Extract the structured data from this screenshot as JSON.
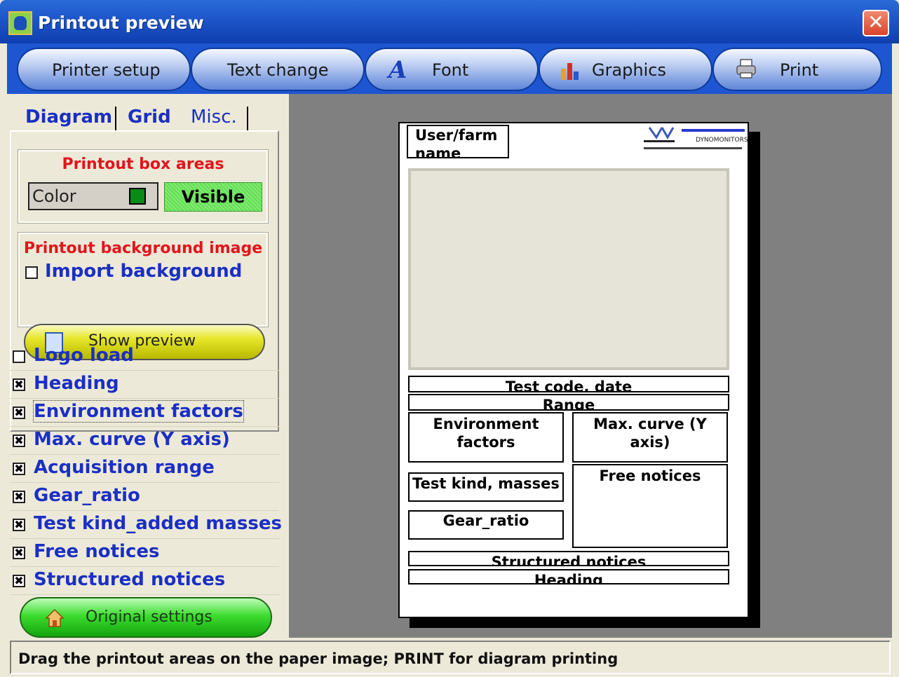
{
  "window": {
    "title": "Printout preview",
    "close_label": "✕"
  },
  "toolbar": {
    "printer_setup": "Printer setup",
    "text_change": "Text change",
    "font": "Font",
    "graphics": "Graphics",
    "print": "Print"
  },
  "tabs": {
    "diagram": "Diagram",
    "grid": "Grid",
    "misc": "Misc.",
    "active": "Misc."
  },
  "box_areas": {
    "title": "Printout box areas",
    "color_label": "Color",
    "color_value": "#0a8a16",
    "visible_label": "Visible"
  },
  "background": {
    "title": "Printout background image",
    "import_label": "Import background",
    "import_checked": false,
    "preview_label": "Show preview"
  },
  "options": [
    {
      "label": "Logo load",
      "mark": "",
      "checked": false
    },
    {
      "label": "Heading",
      "mark": "✖",
      "checked": true
    },
    {
      "label": "Environment factors",
      "mark": "✖",
      "checked": true
    },
    {
      "label": "Max. curve (Y axis)",
      "mark": "✖",
      "checked": true
    },
    {
      "label": "Acquisition range",
      "mark": "✖",
      "checked": true
    },
    {
      "label": "Gear_ratio",
      "mark": "✖",
      "checked": true
    },
    {
      "label": "Test kind_added masses",
      "mark": "✖",
      "checked": true
    },
    {
      "label": "Free notices",
      "mark": "✖",
      "checked": true
    },
    {
      "label": "Structured notices",
      "mark": "✖",
      "checked": true
    }
  ],
  "original_settings": "Original settings",
  "paper": {
    "user_farm": "User/farm name",
    "test_code": "Test code, date",
    "range": "Range",
    "environment": "Environment factors",
    "max_curve": "Max. curve (Y axis)",
    "test_kind": "Test kind, masses",
    "free_notices": "Free notices",
    "gear_ratio": "Gear_ratio",
    "structured": "Structured notices",
    "heading": "Heading",
    "logo_line1": "DYNOMONITORS"
  },
  "status": "Drag the printout areas on the paper image; PRINT for diagram printing"
}
